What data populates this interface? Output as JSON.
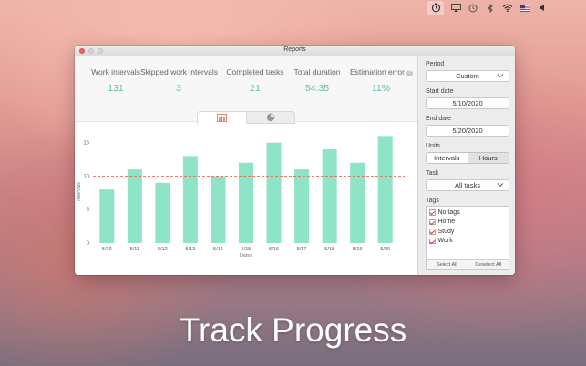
{
  "window": {
    "title": "Reports"
  },
  "stats": [
    {
      "label": "Work intervals",
      "value": "131"
    },
    {
      "label": "Skipped work intervals",
      "value": "3"
    },
    {
      "label": "Completed tasks",
      "value": "21"
    },
    {
      "label": "Total duration",
      "value": "54:35"
    },
    {
      "label": "Estimation error",
      "value": "11%"
    }
  ],
  "tabs": [
    {
      "icon": "bar-chart-icon",
      "selected": true
    },
    {
      "icon": "pie-chart-icon",
      "selected": false
    }
  ],
  "sidebar": {
    "period": {
      "label": "Period",
      "value": "Custom"
    },
    "start_date": {
      "label": "Start date",
      "value": "5/10/2020"
    },
    "end_date": {
      "label": "End date",
      "value": "5/20/2020"
    },
    "units": {
      "label": "Units",
      "options": [
        "Intervals",
        "Hours"
      ],
      "selected": "Intervals"
    },
    "task": {
      "label": "Task",
      "value": "All tasks"
    },
    "tags": {
      "label": "Tags",
      "items": [
        {
          "label": "No tags",
          "checked": true
        },
        {
          "label": "Home",
          "checked": true
        },
        {
          "label": "Study",
          "checked": true
        },
        {
          "label": "Work",
          "checked": true
        }
      ],
      "select_all": "Select All",
      "deselect_all": "Deselect All"
    }
  },
  "headline": "Track Progress",
  "colors": {
    "bar": "#8fe3c7",
    "value": "#5ac39e",
    "average_line": "#e86c5c",
    "checkbox": "#d83a3a"
  },
  "chart_data": {
    "type": "bar",
    "categories": [
      "5/10",
      "5/11",
      "5/12",
      "5/13",
      "5/14",
      "5/15",
      "5/16",
      "5/17",
      "5/18",
      "5/19",
      "5/20"
    ],
    "values": [
      8,
      11,
      9,
      13,
      10,
      12,
      15,
      11,
      14,
      12,
      16
    ],
    "average": 10,
    "xlabel": "Dates",
    "ylabel": "Intervals",
    "yticks": [
      0,
      5,
      10,
      15
    ],
    "ylim": [
      0,
      17
    ],
    "grid": false
  }
}
